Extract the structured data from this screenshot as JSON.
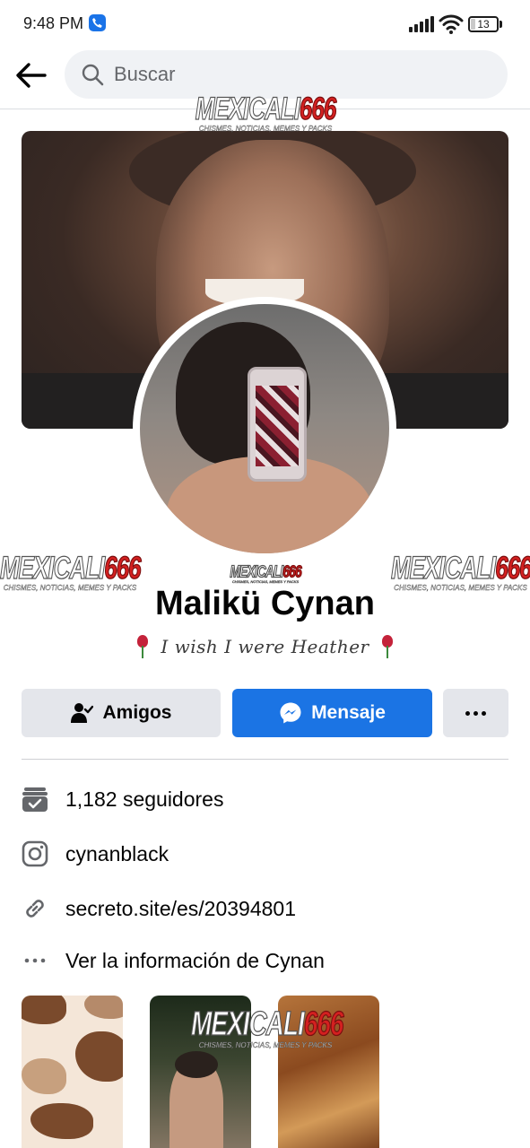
{
  "status_bar": {
    "time": "9:48 PM",
    "battery": "13",
    "icons": [
      "call-icon",
      "signal-icon",
      "wifi-icon",
      "battery-icon"
    ]
  },
  "header": {
    "back_icon": "arrow-left-icon",
    "search_placeholder": "Buscar"
  },
  "watermark": {
    "text": "MEXICALI",
    "number": "666",
    "tagline": "CHISMES, NOTICIAS, MEMES Y PACKS"
  },
  "profile": {
    "name": "Malikü Cynan",
    "bio": "I wish I were Heather",
    "bio_icon": "rose-icon"
  },
  "actions": {
    "friends_label": "Amigos",
    "message_label": "Mensaje",
    "more_icon": "more-dots-icon"
  },
  "info": {
    "followers": "1,182 seguidores",
    "instagram": "cynanblack",
    "link": "secreto.site/es/20394801",
    "see_info": "Ver la información de Cynan"
  },
  "colors": {
    "accent": "#1b74e4",
    "button_gray": "#e4e6eb",
    "search_bg": "#f0f2f5",
    "text_primary": "#050505",
    "text_secondary": "#65676b"
  }
}
